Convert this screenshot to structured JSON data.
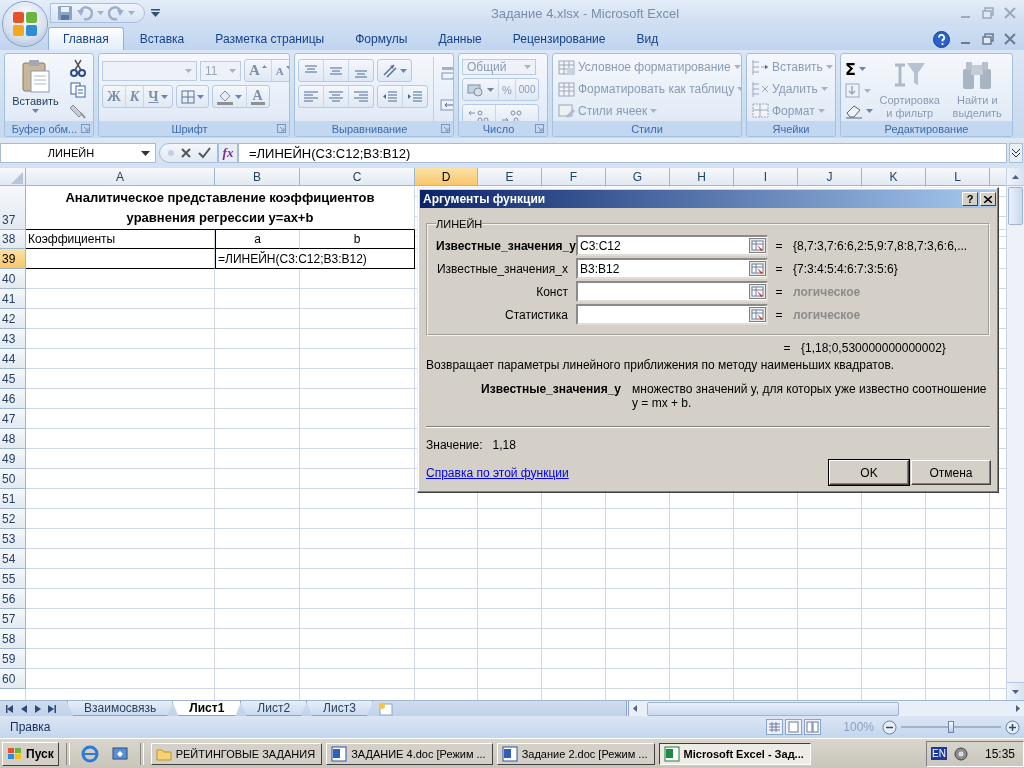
{
  "window": {
    "title": "Задание 4.xlsx - Microsoft Excel"
  },
  "tabs": [
    {
      "label": "Главная",
      "selected": true
    },
    {
      "label": "Вставка",
      "selected": false
    },
    {
      "label": "Разметка страницы",
      "selected": false
    },
    {
      "label": "Формулы",
      "selected": false
    },
    {
      "label": "Данные",
      "selected": false
    },
    {
      "label": "Рецензирование",
      "selected": false
    },
    {
      "label": "Вид",
      "selected": false
    }
  ],
  "ribbon": {
    "groups": [
      {
        "kind": "clipboard",
        "label": "Буфер обм...",
        "launcher": true,
        "paste": "Вставить"
      },
      {
        "kind": "font",
        "label": "Шрифт",
        "launcher": true,
        "font_size": "11",
        "grow_font": "A",
        "shrink_font": "A",
        "bold": "Ж",
        "italic": "К",
        "underline": "Ч",
        "font_color": "A"
      },
      {
        "kind": "alignment",
        "label": "Выравнивание",
        "launcher": true
      },
      {
        "kind": "number",
        "label": "Число",
        "launcher": true,
        "format": "Общий",
        "percent": "%",
        "thousands": "000"
      },
      {
        "kind": "styles",
        "label": "Стили",
        "launcher": false,
        "commands": [
          {
            "label": "Условное форматирование",
            "disabled": true
          },
          {
            "label": "Форматировать как таблицу",
            "disabled": true
          },
          {
            "label": "Стили ячеек",
            "disabled": true
          }
        ]
      },
      {
        "kind": "cells",
        "label": "Ячейки",
        "launcher": false,
        "commands": [
          {
            "label": "Вставить",
            "disabled": true
          },
          {
            "label": "Удалить",
            "disabled": true
          },
          {
            "label": "Формат",
            "disabled": true
          }
        ]
      },
      {
        "kind": "editing",
        "label": "Редактирование",
        "launcher": false,
        "sum": "Σ",
        "commands": [
          {
            "label": "Сортировка и фильтр",
            "disabled": true
          },
          {
            "label": "Найти и выделить",
            "disabled": true
          }
        ]
      }
    ]
  },
  "formula_bar": {
    "name_box": "ЛИНЕЙН",
    "function_button": "fx",
    "formula": "=ЛИНЕЙН(C3:C12;B3:B12)"
  },
  "sheet": {
    "columns": [
      {
        "label": "A",
        "selected": false
      },
      {
        "label": "B",
        "selected": false
      },
      {
        "label": "C",
        "selected": false
      },
      {
        "label": "D",
        "selected": true
      },
      {
        "label": "E",
        "selected": false
      },
      {
        "label": "F",
        "selected": false
      },
      {
        "label": "G",
        "selected": false
      },
      {
        "label": "H",
        "selected": false
      },
      {
        "label": "I",
        "selected": false
      },
      {
        "label": "J",
        "selected": false
      },
      {
        "label": "K",
        "selected": false
      },
      {
        "label": "L",
        "selected": false
      }
    ],
    "rows": [
      {
        "number": "37",
        "selected": false,
        "kind": "title",
        "text": "Аналитическое представление коэффициентов уравнения регрессии y=ax+b"
      },
      {
        "number": "38",
        "selected": false,
        "kind": "header",
        "cells": [
          "Коэффициенты",
          "a",
          "b"
        ]
      },
      {
        "number": "39",
        "selected": true,
        "kind": "editing",
        "text": "=ЛИНЕЙН(C3:C12;B3:B12)"
      },
      {
        "number": "40",
        "selected": false,
        "kind": "empty"
      },
      {
        "number": "41",
        "selected": false,
        "kind": "empty"
      },
      {
        "number": "42",
        "selected": false,
        "kind": "empty"
      },
      {
        "number": "43",
        "selected": false,
        "kind": "empty"
      },
      {
        "number": "44",
        "selected": false,
        "kind": "empty"
      },
      {
        "number": "45",
        "selected": false,
        "kind": "empty"
      },
      {
        "number": "46",
        "selected": false,
        "kind": "empty"
      },
      {
        "number": "47",
        "selected": false,
        "kind": "empty"
      },
      {
        "number": "48",
        "selected": false,
        "kind": "empty"
      },
      {
        "number": "49",
        "selected": false,
        "kind": "empty"
      },
      {
        "number": "50",
        "selected": false,
        "kind": "empty"
      },
      {
        "number": "51",
        "selected": false,
        "kind": "empty"
      },
      {
        "number": "52",
        "selected": false,
        "kind": "empty"
      },
      {
        "number": "53",
        "selected": false,
        "kind": "empty"
      },
      {
        "number": "54",
        "selected": false,
        "kind": "empty"
      },
      {
        "number": "55",
        "selected": false,
        "kind": "empty"
      },
      {
        "number": "56",
        "selected": false,
        "kind": "empty"
      },
      {
        "number": "57",
        "selected": false,
        "kind": "empty"
      },
      {
        "number": "58",
        "selected": false,
        "kind": "empty"
      },
      {
        "number": "59",
        "selected": false,
        "kind": "empty"
      },
      {
        "number": "60",
        "selected": false,
        "kind": "empty"
      }
    ]
  },
  "dialog": {
    "title": "Аргументы функции",
    "help": "?",
    "function": "ЛИНЕЙН",
    "arguments": [
      {
        "label": "Известные_значения_y",
        "active": true,
        "value": "C3:C12",
        "equals": "=",
        "result": "{8,7:3,7:6:6,2:5,9:7,8:8,7:3,6:6,...",
        "kind": "value"
      },
      {
        "label": "Известные_значения_x",
        "active": false,
        "value": "B3:B12",
        "equals": "=",
        "result": "{7:3:4:5:4:6:7:3:5:6}",
        "kind": "value"
      },
      {
        "label": "Конст",
        "active": false,
        "equals": "=",
        "result": "логическое",
        "kind": "type"
      },
      {
        "label": "Статистика",
        "active": false,
        "equals": "=",
        "result": "логическое",
        "kind": "type"
      }
    ],
    "total": {
      "equals": "=",
      "result": "{1,18;0,530000000000002}"
    },
    "description": "Возвращает параметры линейного приближения по методу наименьших квадратов.",
    "argument_help": {
      "name": "Известные_значения_y",
      "text": "множество значений y, для которых уже известно соотношение y = mx + b."
    },
    "value_label": "Значение:",
    "value": "1,18",
    "help_link": "Справка по этой функции",
    "buttons": [
      "OK",
      "Отмена"
    ]
  },
  "sheet_tabs": {
    "tabs": [
      {
        "label": "Взаимосвязь",
        "selected": false
      },
      {
        "label": "Лист1",
        "selected": true
      },
      {
        "label": "Лист2",
        "selected": false
      },
      {
        "label": "Лист3",
        "selected": false
      }
    ]
  },
  "status_bar": {
    "mode": "Правка",
    "zoom": {
      "label": "100%",
      "level": 0.5
    }
  },
  "taskbar": {
    "start": "Пуск",
    "tasks": [
      {
        "label": "РЕЙТИНГОВЫЕ ЗАДАНИЯ",
        "kind": "folder",
        "selected": false
      },
      {
        "label": "ЗАДАНИЕ 4.doc [Режим ...",
        "kind": "word",
        "selected": false
      },
      {
        "label": "Задание 2.doc [Режим ...",
        "kind": "word",
        "selected": false
      },
      {
        "label": "Microsoft Excel - Зад...",
        "kind": "excel",
        "selected": true
      }
    ],
    "language": "EN",
    "clock": "15:35"
  }
}
